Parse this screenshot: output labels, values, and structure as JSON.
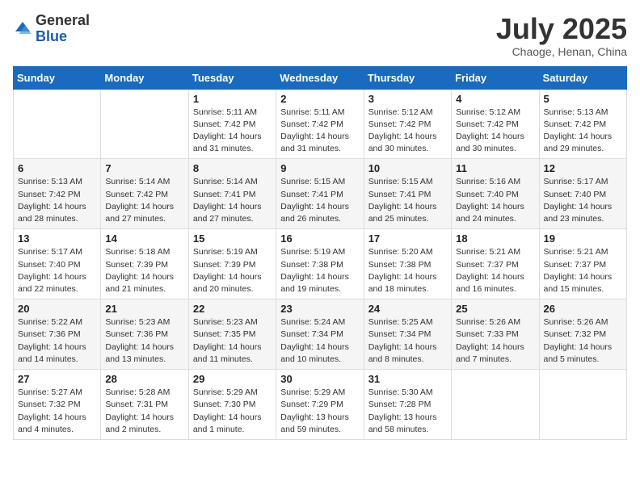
{
  "logo": {
    "general": "General",
    "blue": "Blue"
  },
  "title": "July 2025",
  "location": "Chaoge, Henan, China",
  "weekdays": [
    "Sunday",
    "Monday",
    "Tuesday",
    "Wednesday",
    "Thursday",
    "Friday",
    "Saturday"
  ],
  "weeks": [
    [
      null,
      null,
      {
        "day": "1",
        "sunrise": "5:11 AM",
        "sunset": "7:42 PM",
        "daylight": "14 hours and 31 minutes."
      },
      {
        "day": "2",
        "sunrise": "5:11 AM",
        "sunset": "7:42 PM",
        "daylight": "14 hours and 31 minutes."
      },
      {
        "day": "3",
        "sunrise": "5:12 AM",
        "sunset": "7:42 PM",
        "daylight": "14 hours and 30 minutes."
      },
      {
        "day": "4",
        "sunrise": "5:12 AM",
        "sunset": "7:42 PM",
        "daylight": "14 hours and 30 minutes."
      },
      {
        "day": "5",
        "sunrise": "5:13 AM",
        "sunset": "7:42 PM",
        "daylight": "14 hours and 29 minutes."
      }
    ],
    [
      {
        "day": "6",
        "sunrise": "5:13 AM",
        "sunset": "7:42 PM",
        "daylight": "14 hours and 28 minutes."
      },
      {
        "day": "7",
        "sunrise": "5:14 AM",
        "sunset": "7:42 PM",
        "daylight": "14 hours and 27 minutes."
      },
      {
        "day": "8",
        "sunrise": "5:14 AM",
        "sunset": "7:41 PM",
        "daylight": "14 hours and 27 minutes."
      },
      {
        "day": "9",
        "sunrise": "5:15 AM",
        "sunset": "7:41 PM",
        "daylight": "14 hours and 26 minutes."
      },
      {
        "day": "10",
        "sunrise": "5:15 AM",
        "sunset": "7:41 PM",
        "daylight": "14 hours and 25 minutes."
      },
      {
        "day": "11",
        "sunrise": "5:16 AM",
        "sunset": "7:40 PM",
        "daylight": "14 hours and 24 minutes."
      },
      {
        "day": "12",
        "sunrise": "5:17 AM",
        "sunset": "7:40 PM",
        "daylight": "14 hours and 23 minutes."
      }
    ],
    [
      {
        "day": "13",
        "sunrise": "5:17 AM",
        "sunset": "7:40 PM",
        "daylight": "14 hours and 22 minutes."
      },
      {
        "day": "14",
        "sunrise": "5:18 AM",
        "sunset": "7:39 PM",
        "daylight": "14 hours and 21 minutes."
      },
      {
        "day": "15",
        "sunrise": "5:19 AM",
        "sunset": "7:39 PM",
        "daylight": "14 hours and 20 minutes."
      },
      {
        "day": "16",
        "sunrise": "5:19 AM",
        "sunset": "7:38 PM",
        "daylight": "14 hours and 19 minutes."
      },
      {
        "day": "17",
        "sunrise": "5:20 AM",
        "sunset": "7:38 PM",
        "daylight": "14 hours and 18 minutes."
      },
      {
        "day": "18",
        "sunrise": "5:21 AM",
        "sunset": "7:37 PM",
        "daylight": "14 hours and 16 minutes."
      },
      {
        "day": "19",
        "sunrise": "5:21 AM",
        "sunset": "7:37 PM",
        "daylight": "14 hours and 15 minutes."
      }
    ],
    [
      {
        "day": "20",
        "sunrise": "5:22 AM",
        "sunset": "7:36 PM",
        "daylight": "14 hours and 14 minutes."
      },
      {
        "day": "21",
        "sunrise": "5:23 AM",
        "sunset": "7:36 PM",
        "daylight": "14 hours and 13 minutes."
      },
      {
        "day": "22",
        "sunrise": "5:23 AM",
        "sunset": "7:35 PM",
        "daylight": "14 hours and 11 minutes."
      },
      {
        "day": "23",
        "sunrise": "5:24 AM",
        "sunset": "7:34 PM",
        "daylight": "14 hours and 10 minutes."
      },
      {
        "day": "24",
        "sunrise": "5:25 AM",
        "sunset": "7:34 PM",
        "daylight": "14 hours and 8 minutes."
      },
      {
        "day": "25",
        "sunrise": "5:26 AM",
        "sunset": "7:33 PM",
        "daylight": "14 hours and 7 minutes."
      },
      {
        "day": "26",
        "sunrise": "5:26 AM",
        "sunset": "7:32 PM",
        "daylight": "14 hours and 5 minutes."
      }
    ],
    [
      {
        "day": "27",
        "sunrise": "5:27 AM",
        "sunset": "7:32 PM",
        "daylight": "14 hours and 4 minutes."
      },
      {
        "day": "28",
        "sunrise": "5:28 AM",
        "sunset": "7:31 PM",
        "daylight": "14 hours and 2 minutes."
      },
      {
        "day": "29",
        "sunrise": "5:29 AM",
        "sunset": "7:30 PM",
        "daylight": "14 hours and 1 minute."
      },
      {
        "day": "30",
        "sunrise": "5:29 AM",
        "sunset": "7:29 PM",
        "daylight": "13 hours and 59 minutes."
      },
      {
        "day": "31",
        "sunrise": "5:30 AM",
        "sunset": "7:28 PM",
        "daylight": "13 hours and 58 minutes."
      },
      null,
      null
    ]
  ]
}
